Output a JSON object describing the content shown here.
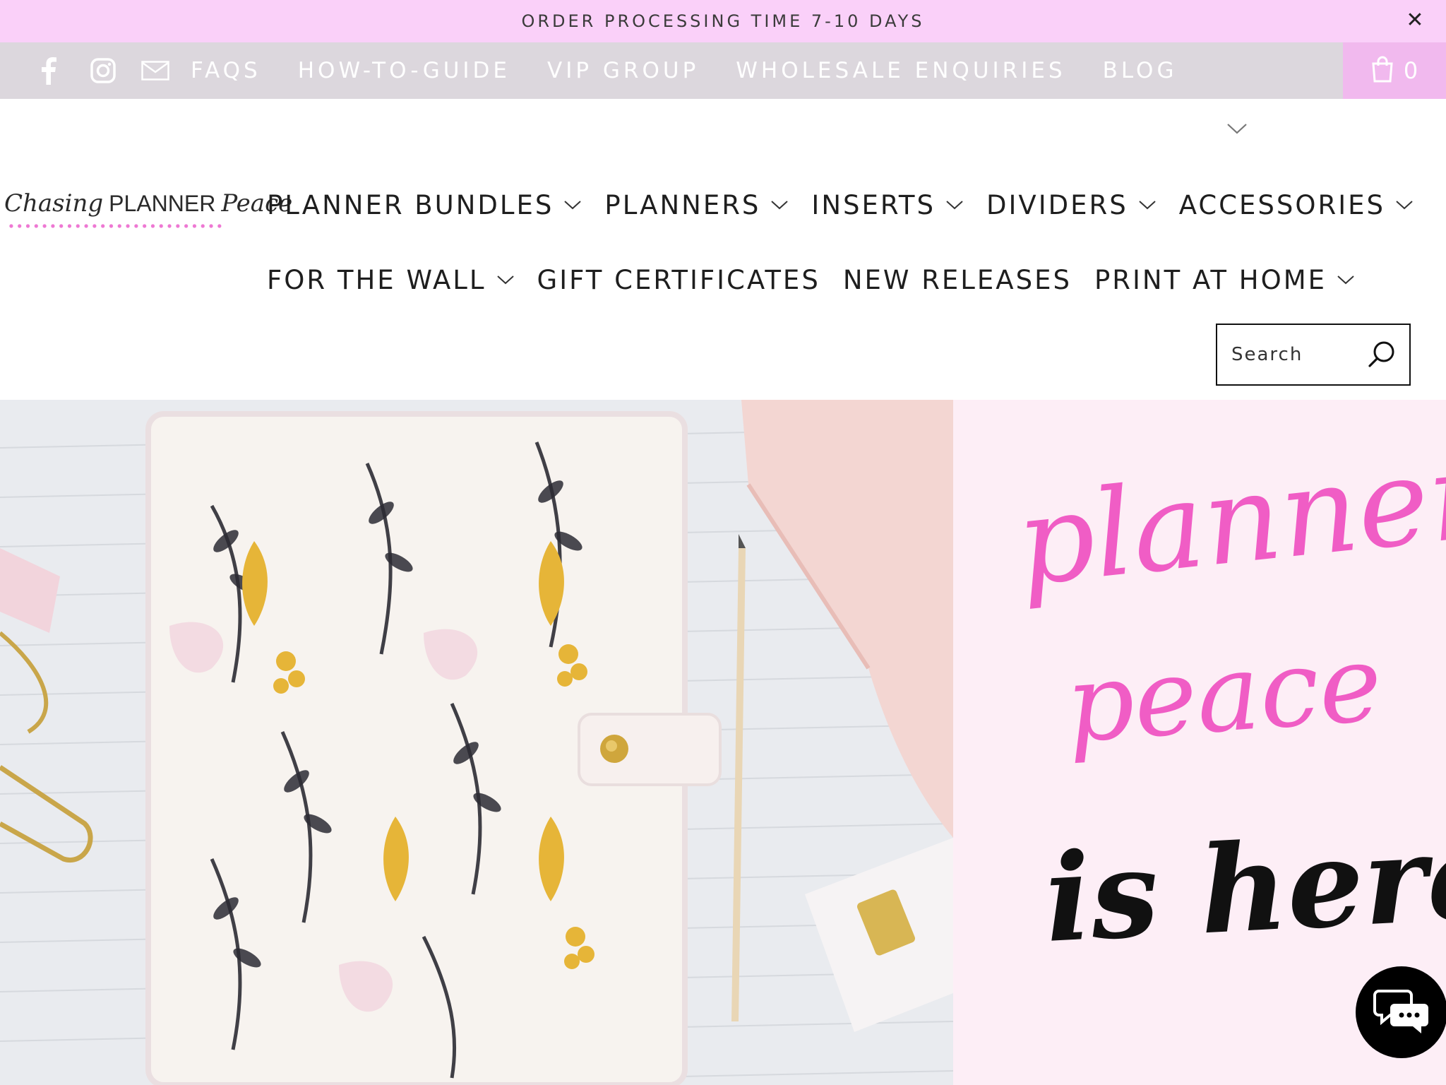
{
  "announcement": {
    "text": "ORDER PROCESSING TIME 7-10 DAYS",
    "close_icon": "close-icon"
  },
  "topbar": {
    "social": [
      {
        "name": "facebook",
        "icon": "facebook-icon"
      },
      {
        "name": "instagram",
        "icon": "instagram-icon"
      },
      {
        "name": "email",
        "icon": "mail-icon"
      }
    ],
    "links": [
      "FAQS",
      "HOW-TO-GUIDE",
      "VIP GROUP",
      "WHOLESALE ENQUIRIES",
      "BLOG"
    ],
    "cart": {
      "icon": "shopping-bag-icon",
      "count": "0"
    }
  },
  "logo": {
    "script_left": "Chasing",
    "caps": "PLANNER",
    "script_right": "Peace"
  },
  "main_nav": {
    "row1": [
      {
        "label": "PLANNER BUNDLES",
        "has_dropdown": true
      },
      {
        "label": "PLANNERS",
        "has_dropdown": true
      },
      {
        "label": "INSERTS",
        "has_dropdown": true
      },
      {
        "label": "DIVIDERS",
        "has_dropdown": true
      },
      {
        "label": "ACCESSORIES",
        "has_dropdown": true
      }
    ],
    "row2": [
      {
        "label": "FOR THE WALL",
        "has_dropdown": true
      },
      {
        "label": "GIFT CERTIFICATES",
        "has_dropdown": false
      },
      {
        "label": "NEW RELEASES",
        "has_dropdown": false
      },
      {
        "label": "PRINT AT HOME",
        "has_dropdown": true
      }
    ]
  },
  "search": {
    "placeholder": "Search",
    "icon": "search-icon"
  },
  "hero": {
    "line1": "planner",
    "line2": "peace",
    "line3": "is here",
    "colors": {
      "pink": "#f05dc5",
      "panel": "#fdeef6",
      "black": "#111111"
    }
  },
  "colors": {
    "announcement_bg": "#fad0f9",
    "topbar_bg": "#dcd7dd",
    "cart_bg": "#f1b9ee"
  },
  "chat": {
    "icon": "chat-icon"
  }
}
